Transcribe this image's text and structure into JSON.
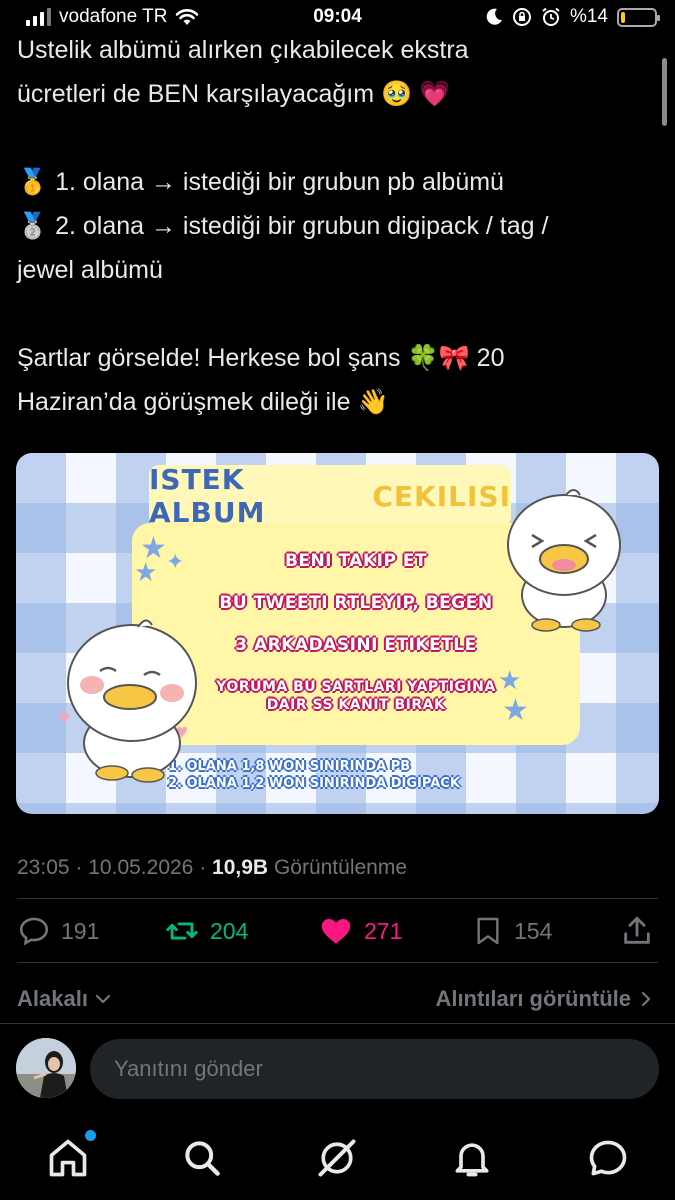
{
  "status_bar": {
    "carrier": "vodafone TR",
    "time": "09:04",
    "battery": "%14",
    "battery_level": 0.14,
    "battery_color": "#ffcc00"
  },
  "tweet": {
    "lines": [
      "Ustelik albümü alırken çıkabilecek ekstra",
      "ücretleri de BEN karşılayacağım 🥹 💗",
      "",
      "🥇 1. olana → istediği bir grubun pb albümü",
      "🥈 2. olana → istediği bir grubun digipack / tag /",
      "jewel albümü",
      "",
      "Şartlar görselde! Herkese bol şans 🍀🎀 20",
      "Haziran’da görüşmek dileği ile 👋"
    ]
  },
  "media": {
    "title_part1": "ISTEK ALBUM",
    "title_part2": "CEKILISI",
    "rules": [
      "BENI TAKIP ET",
      "BU TWEETI RTLEYIP, BEGEN",
      "3 ARKADASINI ETIKETLE"
    ],
    "rule4_line1": "YORUMA BU SARTLARI YAPTIGINA",
    "rule4_line2": "DAIR SS KANIT BIRAK",
    "prize1": "1. OLANA 1,8 WON SINIRINDA PB",
    "prize2": "2. OLANA 1,2 WON SINIRINDA DIGIPACK"
  },
  "meta": {
    "time": "23:05",
    "sep1": "·",
    "date": "10.05.2026",
    "sep2": "·",
    "views_count": "10,9B",
    "views_label": "Görüntülenme"
  },
  "actions": {
    "replies": "191",
    "retweets": "204",
    "likes": "271",
    "bookmarks": "154",
    "retweet_color": "#00ba7c",
    "like_color": "#f91880"
  },
  "related_label": "Alakalı",
  "quotes_label": "Alıntıları görüntüle",
  "reply": {
    "placeholder": "Yanıtını gönder"
  },
  "tabbar": {
    "icons": [
      "home-icon",
      "search-icon",
      "grok-icon",
      "notifications-icon",
      "messages-icon"
    ]
  },
  "colors": {
    "background": "#000000",
    "text": "#e7e9ea",
    "muted": "#71767b",
    "accent_blue": "#1d9bf0"
  }
}
